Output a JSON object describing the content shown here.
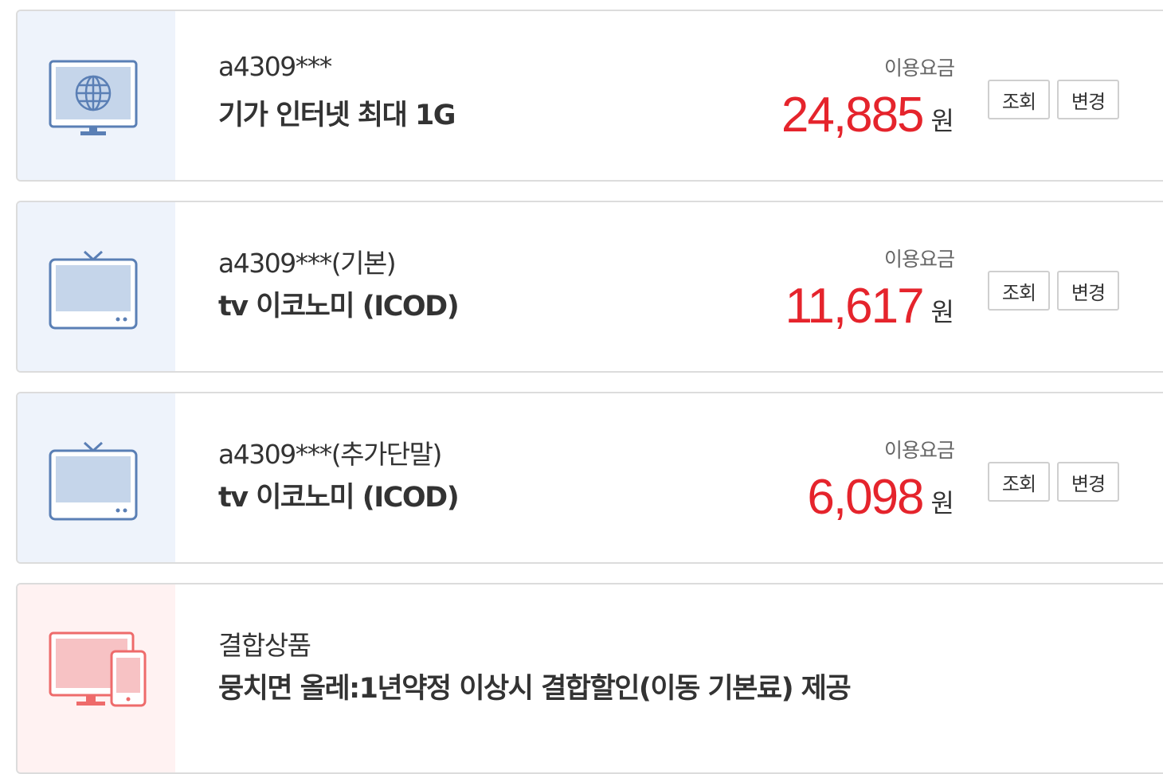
{
  "items": [
    {
      "id_label": "a4309***",
      "product_name": "기가 인터넷 최대 1G",
      "fee_label": "이용요금",
      "fee_amount": "24,885",
      "fee_unit": "원",
      "view_label": "조회",
      "change_label": "변경",
      "icon": "internet-monitor-icon"
    },
    {
      "id_label": "a4309***(기본)",
      "product_name": "tv 이코노미 (ICOD)",
      "fee_label": "이용요금",
      "fee_amount": "11,617",
      "fee_unit": "원",
      "view_label": "조회",
      "change_label": "변경",
      "icon": "tv-icon"
    },
    {
      "id_label": "a4309***(추가단말)",
      "product_name": "tv 이코노미 (ICOD)",
      "fee_label": "이용요금",
      "fee_amount": "6,098",
      "fee_unit": "원",
      "view_label": "조회",
      "change_label": "변경",
      "icon": "tv-icon"
    }
  ],
  "bundle": {
    "title": "결합상품",
    "description": "뭉치면 올레:1년약정 이상시 결합할인(이동 기본료) 제공",
    "icon": "devices-icon"
  },
  "colors": {
    "fee_amount": "#e5242c",
    "icon_blue": "#5a7fb5",
    "icon_bg_blue": "#eef3fb",
    "icon_red": "#ee6b6b",
    "icon_bg_red": "#fff2f2"
  }
}
